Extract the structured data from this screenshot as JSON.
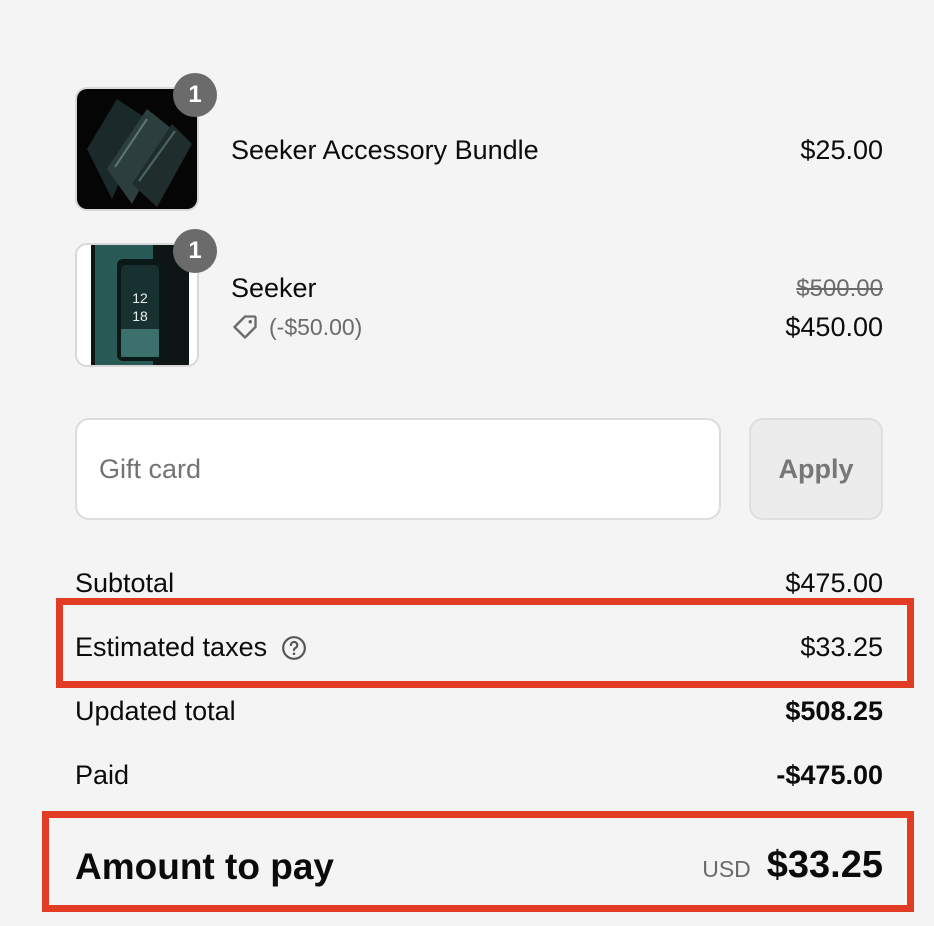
{
  "cart": {
    "items": [
      {
        "name": "Seeker Accessory Bundle",
        "quantity": "1",
        "price": "$25.00",
        "image_icon": "accessory-bundle-photo"
      },
      {
        "name": "Seeker",
        "quantity": "1",
        "original_price": "$500.00",
        "price": "$450.00",
        "discount": "(-$50.00)",
        "discount_icon": "tag-icon",
        "image_icon": "phone-photo",
        "phone_time": [
          "12",
          "18"
        ]
      }
    ]
  },
  "gift_card": {
    "placeholder": "Gift card",
    "apply_label": "Apply"
  },
  "summary": {
    "subtotal_label": "Subtotal",
    "subtotal_value": "$475.00",
    "taxes_label": "Estimated taxes",
    "taxes_value": "$33.25",
    "updated_total_label": "Updated total",
    "updated_total_value": "$508.25",
    "paid_label": "Paid",
    "paid_value": "-$475.00",
    "amount_label": "Amount to pay",
    "currency": "USD",
    "amount_value": "$33.25"
  },
  "colors": {
    "highlight": "#e33c24",
    "badge": "#6b6b6b",
    "background": "#f4f4f4"
  }
}
